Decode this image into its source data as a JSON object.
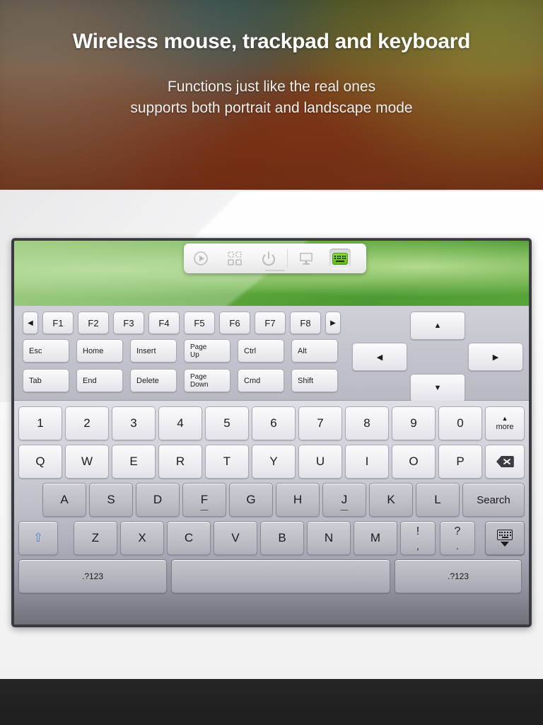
{
  "hero": {
    "title": "Wireless mouse, trackpad and keyboard",
    "subtitle_line1": "Functions just like the real ones",
    "subtitle_line2": "supports both portrait and landscape mode"
  },
  "toolbar": {
    "items": [
      {
        "name": "play-icon",
        "label": ""
      },
      {
        "name": "apps-grid-icon",
        "label": ""
      },
      {
        "name": "power-icon",
        "label": ""
      },
      {
        "name": "monitor-icon",
        "label": ""
      },
      {
        "name": "keyboard-icon",
        "label": "",
        "active": true
      }
    ],
    "accent_color": "#6fbf2a"
  },
  "function_rows": {
    "row1": {
      "prev_label": "◀",
      "next_label": "▶",
      "fkeys": [
        "F1",
        "F2",
        "F3",
        "F4",
        "F5",
        "F6",
        "F7",
        "F8"
      ]
    },
    "row2": [
      "Esc",
      "Home",
      "Insert",
      "Page\nUp",
      "Ctrl",
      "Alt"
    ],
    "row2_flat": [
      "Esc",
      "Home",
      "Insert",
      "Page Up",
      "Ctrl",
      "Alt"
    ],
    "row2_pageup_line1": "Page",
    "row2_pageup_line2": "Up",
    "row3": [
      "Tab",
      "End",
      "Delete",
      "Page\nDown",
      "Cmd",
      "Shift"
    ],
    "row3_pagedown_line1": "Page",
    "row3_pagedown_line2": "Down",
    "arrows": {
      "up": "▲",
      "left": "◀",
      "right": "▶",
      "down": "▼"
    }
  },
  "keyboard": {
    "number_row": [
      "1",
      "2",
      "3",
      "4",
      "5",
      "6",
      "7",
      "8",
      "9",
      "0"
    ],
    "more_key_label": "more",
    "more_key_glyph": "▲",
    "qwerty_row": [
      "Q",
      "W",
      "E",
      "R",
      "T",
      "Y",
      "U",
      "I",
      "O",
      "P"
    ],
    "backspace_name": "backspace-key",
    "home_row": [
      "A",
      "S",
      "D",
      "F",
      "G",
      "H",
      "J",
      "K",
      "L"
    ],
    "search_label": "Search",
    "bottom_letters": [
      "Z",
      "X",
      "C",
      "V",
      "B",
      "N",
      "M"
    ],
    "punct_keys": [
      {
        "top": "!",
        "bottom": ","
      },
      {
        "top": "?",
        "bottom": "."
      }
    ],
    "shift_glyph": "⇧",
    "numeric_toggle_left": ".?123",
    "numeric_toggle_right": ".?123",
    "space_label": "",
    "hide_keyboard_name": "hide-keyboard-key",
    "home_row_markers": [
      "F",
      "J"
    ]
  },
  "colors": {
    "key_face": "#eeeef2",
    "key_face_dark": "#bdbec6",
    "keyboard_bg_top": "#dfe0e6",
    "keyboard_bg_bottom": "#6f7079",
    "device_frame": "#3a3a40",
    "wallpaper_green": "#63ab3f",
    "shift_blue": "#5b86d6",
    "search_gray": "#8d8e98"
  }
}
